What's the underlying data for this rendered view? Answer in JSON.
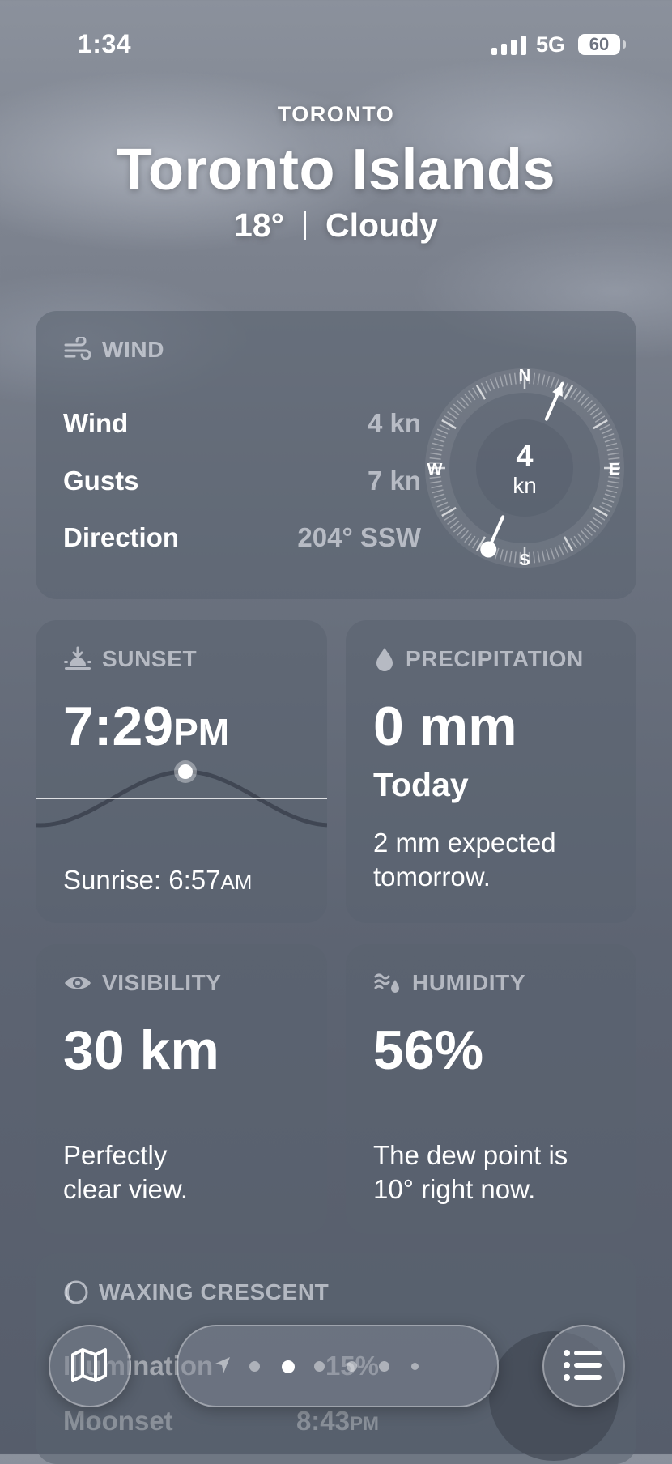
{
  "status_bar": {
    "time": "1:34",
    "network": "5G",
    "battery": "60"
  },
  "header": {
    "city": "TORONTO",
    "place": "Toronto Islands",
    "temperature": "18°",
    "condition": "Cloudy"
  },
  "wind": {
    "title": "WIND",
    "rows": [
      {
        "label": "Wind",
        "value": "4 kn"
      },
      {
        "label": "Gusts",
        "value": "7 kn"
      },
      {
        "label": "Direction",
        "value": "204° SSW"
      }
    ],
    "compass": {
      "north": "N",
      "east": "E",
      "south": "S",
      "west": "W",
      "speed": "4",
      "unit": "kn",
      "direction_degrees": 204
    }
  },
  "sunset": {
    "title": "SUNSET",
    "time": "7:29",
    "ampm": "PM",
    "sunrise_label": "Sunrise: 6:57",
    "sunrise_ampm": "AM"
  },
  "precipitation": {
    "title": "PRECIPITATION",
    "amount": "0 mm",
    "period": "Today",
    "note_line1": "2 mm expected",
    "note_line2": "tomorrow."
  },
  "visibility": {
    "title": "VISIBILITY",
    "value": "30 km",
    "note_line1": "Perfectly",
    "note_line2": "clear view."
  },
  "humidity": {
    "title": "HUMIDITY",
    "value": "56%",
    "note_line1": "The dew point is",
    "note_line2": "10° right now."
  },
  "moon": {
    "title": "WAXING CRESCENT",
    "rows": [
      {
        "label": "Illumination",
        "value": "15%"
      },
      {
        "label": "Moonset",
        "value": "8:43",
        "ampm": "PM"
      }
    ]
  },
  "bottom_bar": {
    "map_icon": "map-icon",
    "list_icon": "list-icon",
    "page_count": 7,
    "active_page": 2
  },
  "colors": {
    "card_bg": "#5a6270",
    "secondary_text": "#ebeef3"
  }
}
